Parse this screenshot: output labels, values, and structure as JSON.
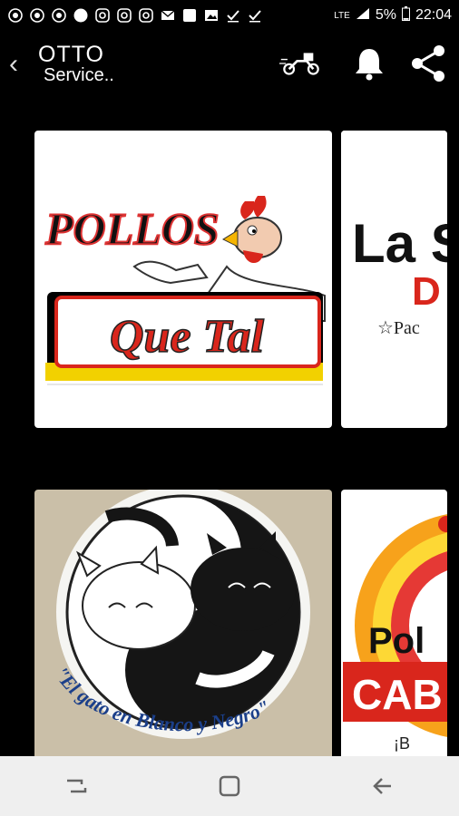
{
  "status": {
    "network": "LTE",
    "battery": "5%",
    "time": "22:04"
  },
  "app": {
    "logo_top": "OTTO",
    "logo_bottom": "Service.."
  },
  "cards": [
    {
      "brand_1": "POLLOS",
      "brand_2": "Que Tal"
    },
    {
      "brand_1": "La S",
      "brand_2": "D",
      "brand_3": "☆Pac"
    },
    {
      "caption": "\"El gato en Blanco y Negro\""
    },
    {
      "brand_1": "Pol",
      "brand_2": "CAB",
      "brand_3": "¡B"
    }
  ]
}
